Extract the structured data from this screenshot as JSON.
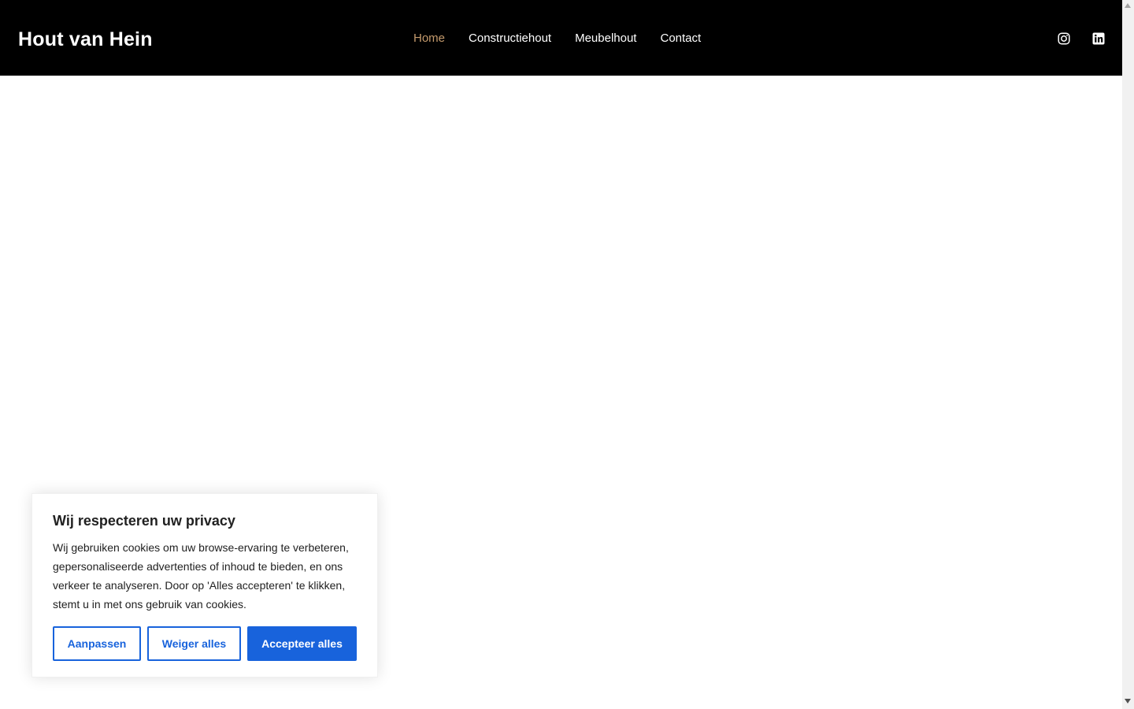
{
  "header": {
    "site_title": "Hout van Hein",
    "nav": [
      {
        "label": "Home",
        "active": true
      },
      {
        "label": "Constructiehout",
        "active": false
      },
      {
        "label": "Meubelhout",
        "active": false
      },
      {
        "label": "Contact",
        "active": false
      }
    ],
    "social_icons": [
      "instagram-icon",
      "linkedin-icon"
    ],
    "background_color": "#000000",
    "active_nav_color": "#c49a6c"
  },
  "cookie_banner": {
    "title": "Wij respecteren uw privacy",
    "text": "Wij gebruiken cookies om uw browse-ervaring te verbeteren, gepersonaliseerde advertenties of inhoud te bieden, en ons verkeer te analyseren. Door op 'Alles accepteren' te klikken, stemt u in met ons gebruik van cookies.",
    "buttons": {
      "customize": "Aanpassen",
      "reject": "Weiger alles",
      "accept": "Accepteer alles"
    },
    "accent_color": "#1863dc"
  }
}
